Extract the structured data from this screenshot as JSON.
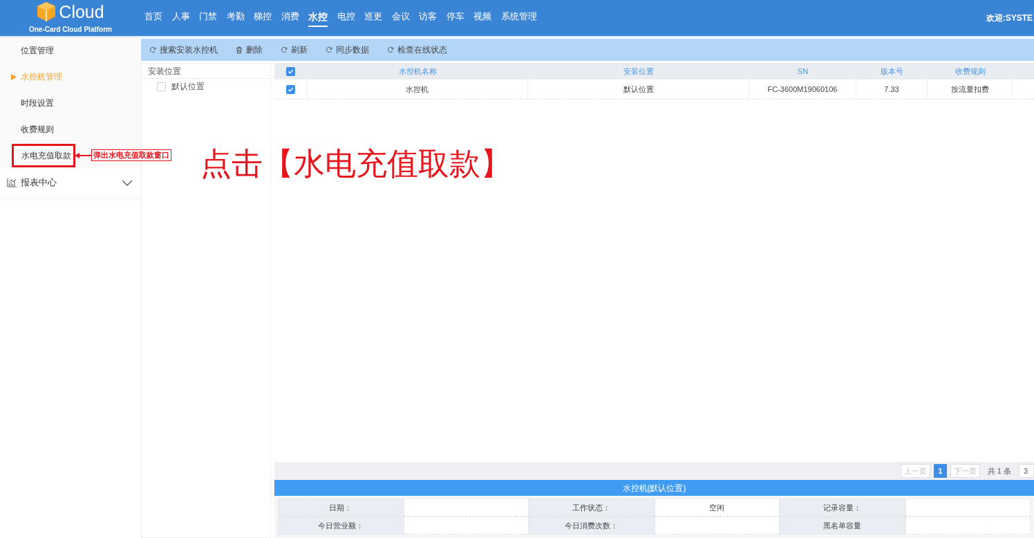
{
  "header": {
    "logo_text": "Cloud",
    "logo_subtitle": "One-Card Cloud Platform",
    "nav": [
      {
        "label": "首页",
        "selected": false
      },
      {
        "label": "人事",
        "selected": false
      },
      {
        "label": "门禁",
        "selected": false
      },
      {
        "label": "考勤",
        "selected": false
      },
      {
        "label": "梯控",
        "selected": false
      },
      {
        "label": "消费",
        "selected": false
      },
      {
        "label": "水控",
        "selected": true
      },
      {
        "label": "电控",
        "selected": false
      },
      {
        "label": "巡更",
        "selected": false
      },
      {
        "label": "会议",
        "selected": false
      },
      {
        "label": "访客",
        "selected": false
      },
      {
        "label": "停车",
        "selected": false
      },
      {
        "label": "视频",
        "selected": false
      },
      {
        "label": "系统管理",
        "selected": false
      }
    ],
    "welcome": "欢迎:SYSTE"
  },
  "sidebar": {
    "items": [
      {
        "kind": "item",
        "label": "位置管理",
        "selected": false,
        "highlighted": false
      },
      {
        "kind": "item",
        "label": "水控机管理",
        "selected": true,
        "highlighted": false
      },
      {
        "kind": "item",
        "label": "时段设置",
        "selected": false,
        "highlighted": false
      },
      {
        "kind": "item",
        "label": "收费规则",
        "selected": false,
        "highlighted": false
      },
      {
        "kind": "item",
        "label": "水电充值取款",
        "selected": false,
        "highlighted": true,
        "callout": "弹出水电充值取款窗口"
      },
      {
        "kind": "group",
        "label": "报表中心",
        "expanded": false
      }
    ]
  },
  "toolbar": [
    {
      "kind": "refresh",
      "label": "搜索安装水控机"
    },
    {
      "kind": "delete",
      "label": "删除"
    },
    {
      "kind": "refresh",
      "label": "刷新"
    },
    {
      "kind": "refresh",
      "label": "同步数据"
    },
    {
      "kind": "refresh",
      "label": "检查在线状态"
    }
  ],
  "tree": {
    "title": "安装位置",
    "items": [
      {
        "label": "默认位置",
        "checked": false
      }
    ]
  },
  "table": {
    "all_checked": true,
    "columns": [
      "水控机名称",
      "安装位置",
      "SN",
      "版本号",
      "收费规则"
    ],
    "rows": [
      {
        "checked": true,
        "cells": [
          "水控机",
          "默认位置",
          "FC-3600M19060106",
          "7.33",
          "按流量扣费"
        ]
      }
    ]
  },
  "pagination": {
    "prev": "上一页",
    "pages": [
      {
        "label": "1",
        "selected": true
      }
    ],
    "next": "下一页",
    "total": "共 1 条",
    "page_size": "3"
  },
  "detail": {
    "title": "水控机(默认位置)",
    "rows": [
      [
        "日期：",
        "",
        "工作状态：",
        "空闲",
        "记录容量：",
        ""
      ],
      [
        "今日营业额：",
        "",
        "今日消费次数：",
        "",
        "黑名单容量",
        ""
      ]
    ]
  },
  "annotation": "点击【水电充值取款】"
}
